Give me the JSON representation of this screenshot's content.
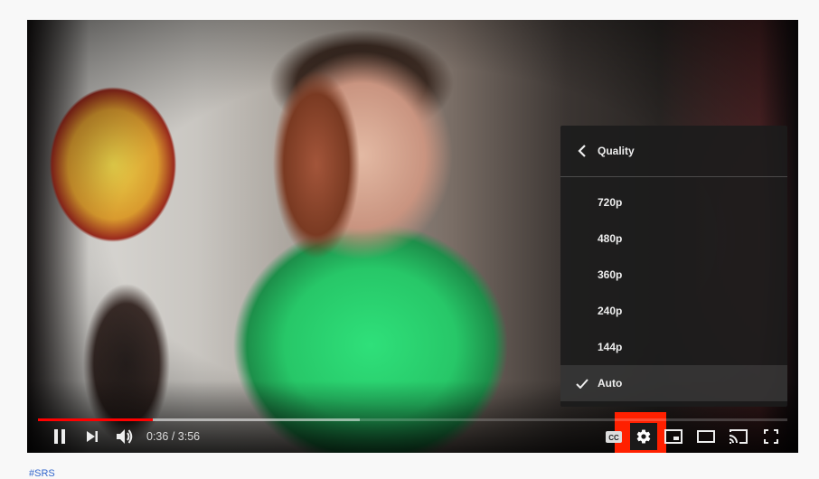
{
  "player": {
    "video_description": "Young man in green hoodie talking to camera in a bedroom (fisheye lens)",
    "progress": {
      "played_fraction": 0.153,
      "buffered_fraction": 0.43
    },
    "time": {
      "current": "0:36",
      "separator": " / ",
      "duration": "3:56"
    },
    "controls": {
      "play_pause": {
        "icon": "pause-icon",
        "label": "Pause"
      },
      "next": {
        "icon": "next-icon",
        "label": "Next"
      },
      "volume": {
        "icon": "volume-icon",
        "label": "Mute"
      },
      "captions": {
        "icon": "cc-icon",
        "label": "Subtitles/closed captions"
      },
      "settings": {
        "icon": "gear-icon",
        "label": "Settings",
        "highlighted": true,
        "highlight_color": "#ff2000"
      },
      "miniplayer": {
        "icon": "miniplayer-icon",
        "label": "Miniplayer"
      },
      "theater": {
        "icon": "theater-mode-icon",
        "label": "Theater mode"
      },
      "cast": {
        "icon": "cast-icon",
        "label": "Play on TV"
      },
      "fullscreen": {
        "icon": "fullscreen-icon",
        "label": "Full screen"
      }
    },
    "quality_menu": {
      "title": "Quality",
      "back_icon": "chevron-left-icon",
      "options": [
        {
          "label": "720p",
          "selected": false
        },
        {
          "label": "480p",
          "selected": false
        },
        {
          "label": "360p",
          "selected": false
        },
        {
          "label": "240p",
          "selected": false
        },
        {
          "label": "144p",
          "selected": false
        },
        {
          "label": "Auto",
          "selected": true
        }
      ]
    },
    "accent_color": "#ff0000"
  },
  "below_player": {
    "hashtag_link": "#SRS"
  }
}
